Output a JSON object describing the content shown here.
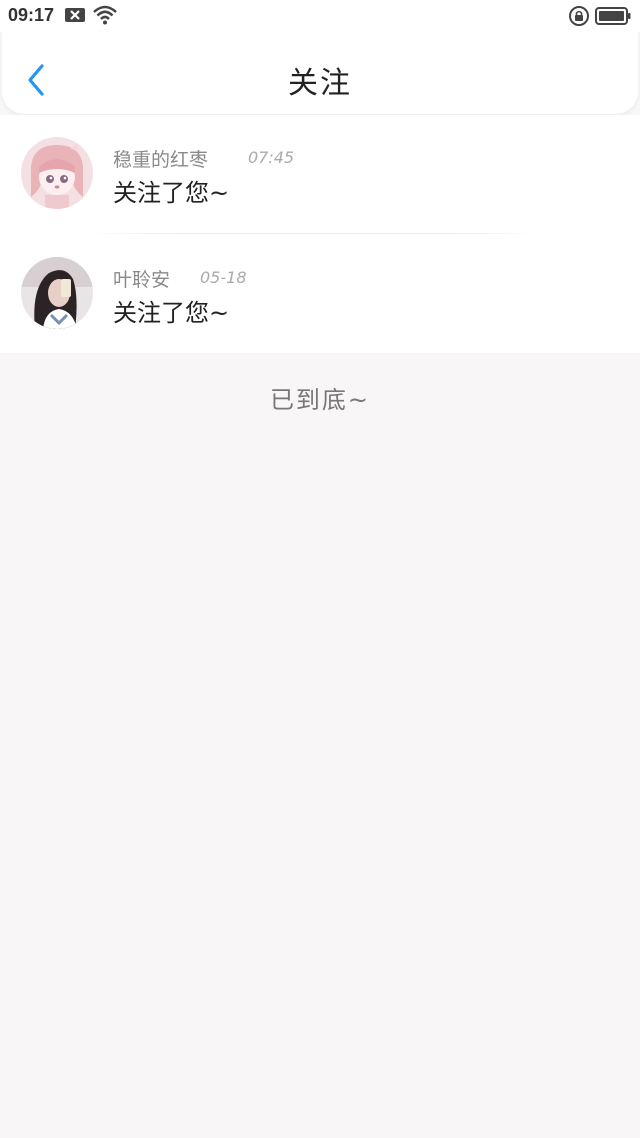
{
  "status_bar": {
    "time": "09:17",
    "icons": [
      "sim-disabled-icon",
      "wifi-icon",
      "rotation-lock-icon",
      "battery-icon"
    ]
  },
  "header": {
    "title": "关注",
    "back_icon": "chevron-left-icon",
    "accent_color": "#2196f3"
  },
  "notifications": [
    {
      "username": "稳重的红枣",
      "time": "07:45",
      "message": "关注了您~"
    },
    {
      "username": "叶聆安",
      "time": "05-18",
      "message": "关注了您~"
    }
  ],
  "footer": {
    "end_text": "已到底~"
  }
}
